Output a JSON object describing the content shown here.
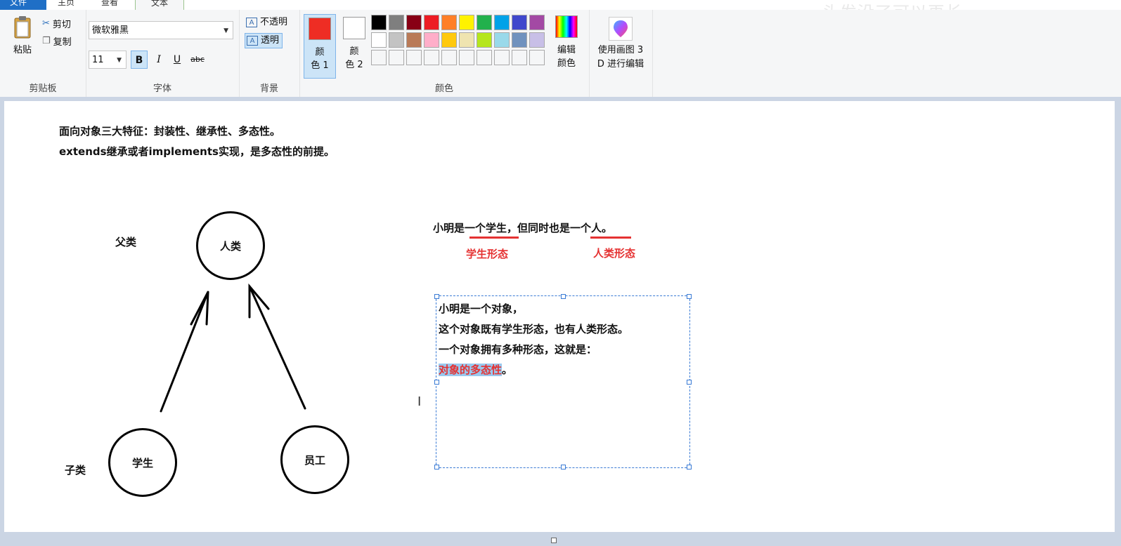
{
  "tabs": {
    "file": "文件",
    "home": "主页",
    "view": "查看",
    "text": "文本"
  },
  "watermark": "头发没了可以再长",
  "clipboard": {
    "paste": "粘贴",
    "cut": "剪切",
    "copy": "复制",
    "group": "剪贴板"
  },
  "font": {
    "family": "微软雅黑",
    "size": "11",
    "bold": "B",
    "italic": "I",
    "underline": "U",
    "strike": "abc",
    "group": "字体"
  },
  "background": {
    "opaque": "不透明",
    "transparent": "透明",
    "group": "背景"
  },
  "colors": {
    "color1_line1": "颜",
    "color1_line2": "色 1",
    "color2_line1": "颜",
    "color2_line2": "色 2",
    "color1_value": "#ee2d24",
    "color2_value": "#ffffff",
    "edit_line1": "编辑",
    "edit_line2": "颜色",
    "group": "颜色",
    "palette": [
      "#000000",
      "#7f7f7f",
      "#880015",
      "#ed1c24",
      "#ff7f27",
      "#fff200",
      "#22b14c",
      "#00a2e8",
      "#3f48cc",
      "#a349a4",
      "#ffffff",
      "#c3c3c3",
      "#b97a57",
      "#ffaec9",
      "#ffc90e",
      "#efe4b0",
      "#b5e61d",
      "#99d9ea",
      "#7092be",
      "#c8bfe7",
      "",
      "",
      "",
      "",
      "",
      "",
      "",
      "",
      "",
      ""
    ]
  },
  "paint3d": {
    "line1": "使用画图 3",
    "line2": "D 进行编辑"
  },
  "canvas": {
    "heading1": "面向对象三大特征：封装性、继承性、多态性。",
    "heading2": "extends继承或者implements实现，是多态性的前提。",
    "parent_label": "父类",
    "child_label": "子类",
    "node_parent": "人类",
    "node_student": "学生",
    "node_employee": "员工",
    "sentence": "小明是一个学生，但同时也是一个人。",
    "form_student": "学生形态",
    "form_human": "人类形态",
    "textbox_line1": "小明是一个对象，",
    "textbox_line2": "这个对象既有学生形态，也有人类形态。",
    "textbox_line3": "一个对象拥有多种形态，这就是：",
    "textbox_line4_selected": "对象的多态性",
    "textbox_line4_rest": "。"
  }
}
